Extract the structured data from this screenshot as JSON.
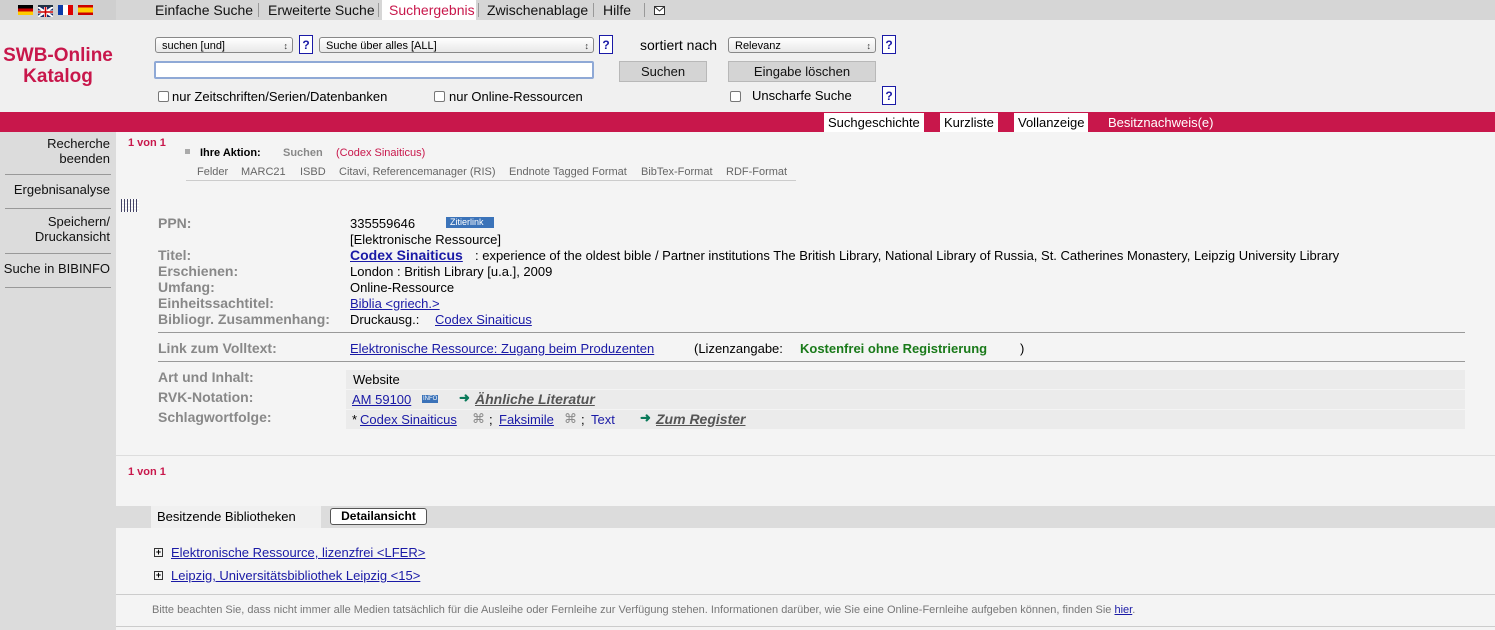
{
  "nav": {
    "items": [
      "Einfache Suche",
      "Erweiterte Suche",
      "Suchergebnis",
      "Zwischenablage",
      "Hilfe"
    ],
    "active": "Suchergebnis",
    "mail_icon": "envelope-icon"
  },
  "flags": [
    "de-flag",
    "gb-flag",
    "fr-flag",
    "es-flag"
  ],
  "logo": {
    "line1": "SWB-Online",
    "line2": "Katalog"
  },
  "search": {
    "operator_select": "suchen [und]",
    "field_select": "Suche über alles [ALL]",
    "sort_label": "sortiert nach",
    "sort_select": "Relevanz",
    "query_value": "",
    "search_button": "Suchen",
    "clear_button": "Eingabe löschen",
    "chk_journals": "nur Zeitschriften/Serien/Datenbanken",
    "chk_online": "nur Online-Ressourcen",
    "chk_fuzzy": "Unscharfe Suche",
    "help": "?"
  },
  "tabs": [
    "Suchgeschichte",
    "Kurzliste",
    "Vollanzeige",
    "Besitznachweis(e)"
  ],
  "sidebar": [
    "Recherche beenden",
    "Ergebnisanalyse",
    "Speichern/ Druckansicht",
    "Suche in BIBINFO"
  ],
  "result": {
    "counter": "1 von 1",
    "action_label": "Ihre Aktion:",
    "action_type": "Suchen",
    "action_query": "(Codex Sinaiticus)",
    "formats": [
      "Felder",
      "MARC21",
      "ISBD",
      "Citavi, Referencemanager (RIS)",
      "Endnote Tagged Format",
      "BibTex-Format",
      "RDF-Format"
    ],
    "ppn_label": "PPN:",
    "ppn_value": "335559646",
    "zitierlink": "Zitierlink",
    "ressource_type": "[Elektronische Ressource]",
    "titel_label": "Titel:",
    "titel_link": "Codex Sinaiticus",
    "titel_rest": ": experience of the oldest bible / Partner institutions The British Library, National Library of Russia, St. Catherines Monastery, Leipzig University Library",
    "erschienen_label": "Erschienen:",
    "erschienen_value": "London : British Library [u.a.], 2009",
    "umfang_label": "Umfang:",
    "umfang_value": "Online-Ressource",
    "einheit_label": "Einheitssachtitel:",
    "einheit_value": "Biblia <griech.>",
    "zusammen_label": "Bibliogr. Zusammenhang:",
    "zusammen_prefix": "Druckausg.:",
    "zusammen_link": "Codex Sinaiticus",
    "volltext_label": "Link zum Volltext:",
    "volltext_link": "Elektronische Ressource: Zugang beim Produzenten",
    "lizenz_prefix": "(Lizenzangabe:",
    "lizenz_value": "Kostenfrei ohne Registrierung",
    "lizenz_suffix": ")",
    "art_label": "Art und Inhalt:",
    "art_value": "Website",
    "rvk_label": "RVK-Notation:",
    "rvk_value": "AM 59100",
    "rvk_info": "INFO",
    "aehnlich": "Ähnliche Literatur",
    "schlag_label": "Schlagwortfolge:",
    "schlag_star": "*",
    "schlag_1": "Codex Sinaiticus",
    "schlag_2": "Faksimile",
    "schlag_3": "Text",
    "schlag_sep": ";",
    "zum_register": "Zum Register",
    "counter_bottom": "1 von 1"
  },
  "holdings": {
    "label": "Besitzende Bibliotheken",
    "detail_button": "Detailansicht",
    "items": [
      "Elektronische Ressource, lizenzfrei <LFER>",
      "Leipzig, Universitätsbibliothek Leipzig <15>"
    ]
  },
  "footer": {
    "text": "Bitte beachten Sie, dass nicht immer alle Medien tatsächlich für die Ausleihe oder Fernleihe zur Verfügung stehen. Informationen darüber, wie Sie eine Online-Fernleihe aufgeben können, finden Sie",
    "link": "hier",
    "end": "."
  },
  "colors": {
    "brand": "#c8174b",
    "link": "#1a1aa6",
    "green": "#1a7a1a"
  }
}
